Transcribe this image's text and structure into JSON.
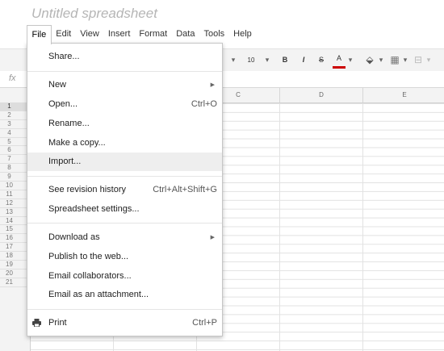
{
  "document": {
    "title": "Untitled spreadsheet"
  },
  "menubar": {
    "items": [
      "File",
      "Edit",
      "View",
      "Insert",
      "Format",
      "Data",
      "Tools",
      "Help"
    ],
    "active": "File"
  },
  "toolbar": {
    "font_size": "10",
    "bold": "B",
    "italic": "I",
    "strikethrough": "S",
    "text_color": "A"
  },
  "formula_bar": {
    "fx": "fx"
  },
  "grid": {
    "columns": [
      "C",
      "D",
      "E"
    ],
    "rows": [
      "1",
      "2",
      "3",
      "4",
      "5",
      "6",
      "7",
      "8",
      "9",
      "10",
      "11",
      "12",
      "13",
      "14",
      "15",
      "16",
      "17",
      "18",
      "19",
      "20",
      "21"
    ],
    "selected_row": "1"
  },
  "file_menu": {
    "share": "Share...",
    "new": "New",
    "open": "Open...",
    "open_shortcut": "Ctrl+O",
    "rename": "Rename...",
    "make_copy": "Make a copy...",
    "import": "Import...",
    "revision_history": "See revision history",
    "revision_shortcut": "Ctrl+Alt+Shift+G",
    "settings": "Spreadsheet settings...",
    "download_as": "Download as",
    "publish": "Publish to the web...",
    "email_collaborators": "Email collaborators...",
    "email_attachment": "Email as an attachment...",
    "print": "Print",
    "print_shortcut": "Ctrl+P",
    "hovered_item": "Import..."
  }
}
